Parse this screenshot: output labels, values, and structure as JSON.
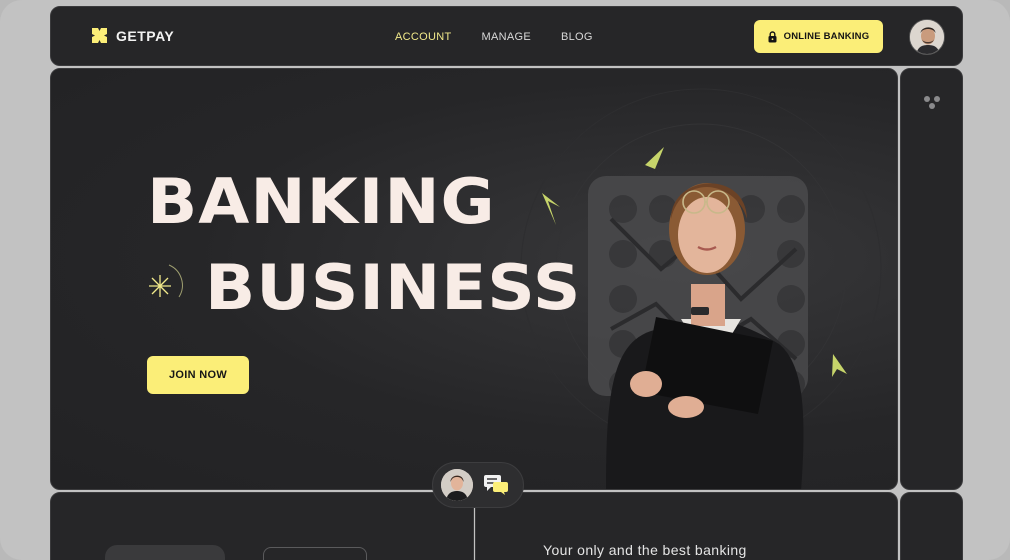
{
  "brand": {
    "name": "GETPAY"
  },
  "nav": {
    "items": [
      {
        "label": "ACCOUNT",
        "active": true
      },
      {
        "label": "MANAGE",
        "active": false
      },
      {
        "label": "BLOG",
        "active": false
      }
    ],
    "cta_label": "ONLINE BANKING",
    "cta_icon": "lock-icon"
  },
  "hero": {
    "line1": "BANKING",
    "line2": "BUSINESS",
    "join_label": "JOIN NOW"
  },
  "bottom": {
    "tagline": "Your only and the best banking"
  },
  "colors": {
    "accent": "#fbee78",
    "panel": "#262628",
    "headline": "#f8ece6"
  }
}
